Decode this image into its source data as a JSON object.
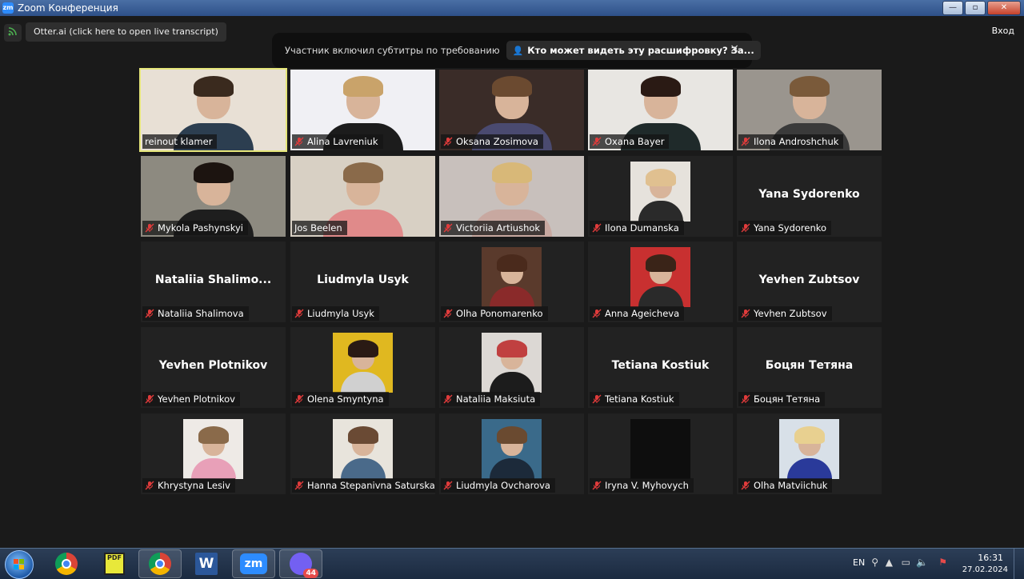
{
  "window": {
    "title": "Zoom Конференция",
    "logo_text": "zm"
  },
  "topbar": {
    "otter_label": "Otter.ai (click here to open live transcript)",
    "exit_label": "Вход"
  },
  "caption_notice": {
    "text": "Участник включил субтитры по требованию",
    "who_can_see": "Кто может видеть эту расшифровку? За...",
    "close_glyph": "×"
  },
  "participants": [
    {
      "name": "reinout klamer",
      "muted": false,
      "active": true,
      "display": "video",
      "bg": "#e8e0d5",
      "hair": "#3a2a1e",
      "shirt": "#2c3e50"
    },
    {
      "name": "Alina Lavreniuk",
      "muted": true,
      "display": "video",
      "bg": "#f0f0f4",
      "hair": "#c9a36a",
      "shirt": "#1c1c1c"
    },
    {
      "name": "Oksana Zosimova",
      "muted": true,
      "display": "video",
      "bg": "#3a2c28",
      "hair": "#6b4a30",
      "shirt": "#4a4a70"
    },
    {
      "name": "Oxana Bayer",
      "muted": true,
      "display": "video",
      "bg": "#e8e6e2",
      "hair": "#2a1a14",
      "shirt": "#1f2a2a"
    },
    {
      "name": "Ilona Androshchuk",
      "muted": true,
      "display": "video",
      "bg": "#9a958e",
      "hair": "#7a5a3a",
      "shirt": "#3a3a3a"
    },
    {
      "name": "Mykola Pashynskyi",
      "muted": true,
      "display": "video",
      "bg": "#8d8a80",
      "hair": "#1c1410",
      "shirt": "#1e1e1e"
    },
    {
      "name": "Jos Beelen",
      "muted": false,
      "display": "video",
      "bg": "#d8d0c4",
      "hair": "#8a6a4a",
      "shirt": "#e08a8a"
    },
    {
      "name": "Victoriia Artiushok",
      "muted": true,
      "display": "video",
      "bg": "#c8c0bc",
      "hair": "#d8b878",
      "shirt": "#c8a8a0"
    },
    {
      "name": "Ilona Dumanska",
      "muted": true,
      "display": "photo",
      "bg": "#e6e2dc",
      "hair": "#e0c090",
      "shirt": "#2a2a2a"
    },
    {
      "name": "Yana Sydorenko",
      "muted": true,
      "display": "name",
      "big_name": "Yana Sydorenko"
    },
    {
      "name": "Nataliia Shalimova",
      "muted": true,
      "display": "name",
      "big_name": "Nataliia  Shalimo..."
    },
    {
      "name": "Liudmyla Usyk",
      "muted": true,
      "display": "name",
      "big_name": "Liudmyla Usyk"
    },
    {
      "name": "Olha Ponomarenko",
      "muted": true,
      "display": "photo",
      "bg": "#5a3a2c",
      "hair": "#4a2a1c",
      "shirt": "#8a2a2a"
    },
    {
      "name": "Anna Ageicheva",
      "muted": true,
      "display": "photo",
      "bg": "#c83030",
      "hair": "#3a2418",
      "shirt": "#2a2a2a"
    },
    {
      "name": "Yevhen Zubtsov",
      "muted": true,
      "display": "name",
      "big_name": "Yevhen Zubtsov"
    },
    {
      "name": "Yevhen Plotnikov",
      "muted": true,
      "display": "name",
      "big_name": "Yevhen Plotnikov"
    },
    {
      "name": "Olena Smyntyna",
      "muted": true,
      "display": "photo",
      "bg": "#e0b820",
      "hair": "#2a1a14",
      "shirt": "#d0d0d0"
    },
    {
      "name": "Nataliia Maksiuta",
      "muted": true,
      "display": "photo",
      "bg": "#dcd8d4",
      "hair": "#c04040",
      "shirt": "#1c1c1c"
    },
    {
      "name": "Tetiana Kostiuk",
      "muted": true,
      "display": "name",
      "big_name": "Tetiana Kostiuk"
    },
    {
      "name": "Боцян Тетяна",
      "muted": true,
      "display": "name",
      "big_name": "Боцян Тетяна"
    },
    {
      "name": "Khrystyna Lesiv",
      "muted": true,
      "display": "photo",
      "bg": "#eeeae6",
      "hair": "#8a6a4a",
      "shirt": "#e8a0b8"
    },
    {
      "name": "Hanna Stepanivna Saturska",
      "muted": true,
      "display": "photo",
      "bg": "#e8e4dc",
      "hair": "#6a4a34",
      "shirt": "#4a6a8a"
    },
    {
      "name": "Liudmyla Ovcharova",
      "muted": true,
      "display": "photo",
      "bg": "#3a6a8a",
      "hair": "#6a4a30",
      "shirt": "#1c2a3a"
    },
    {
      "name": "Iryna V. Myhovych",
      "muted": true,
      "display": "photo",
      "bg": "#0e0e0e",
      "hair": "#0e0e0e",
      "shirt": "#0e0e0e",
      "dark": true
    },
    {
      "name": "Olha Matviichuk",
      "muted": true,
      "display": "photo",
      "bg": "#d8e0e8",
      "hair": "#e8d090",
      "shirt": "#2a3a9a"
    }
  ],
  "taskbar": {
    "apps": [
      {
        "id": "start",
        "label": "Start"
      },
      {
        "id": "chrome",
        "label": "Google Chrome"
      },
      {
        "id": "pdf",
        "label": "PDF"
      },
      {
        "id": "chrome-running",
        "label": "Google Chrome"
      },
      {
        "id": "word",
        "label": "W"
      },
      {
        "id": "zoom",
        "label": "zm"
      },
      {
        "id": "viber",
        "badge": "44"
      }
    ],
    "language": "EN",
    "time": "16:31",
    "date": "27.02.2024"
  }
}
